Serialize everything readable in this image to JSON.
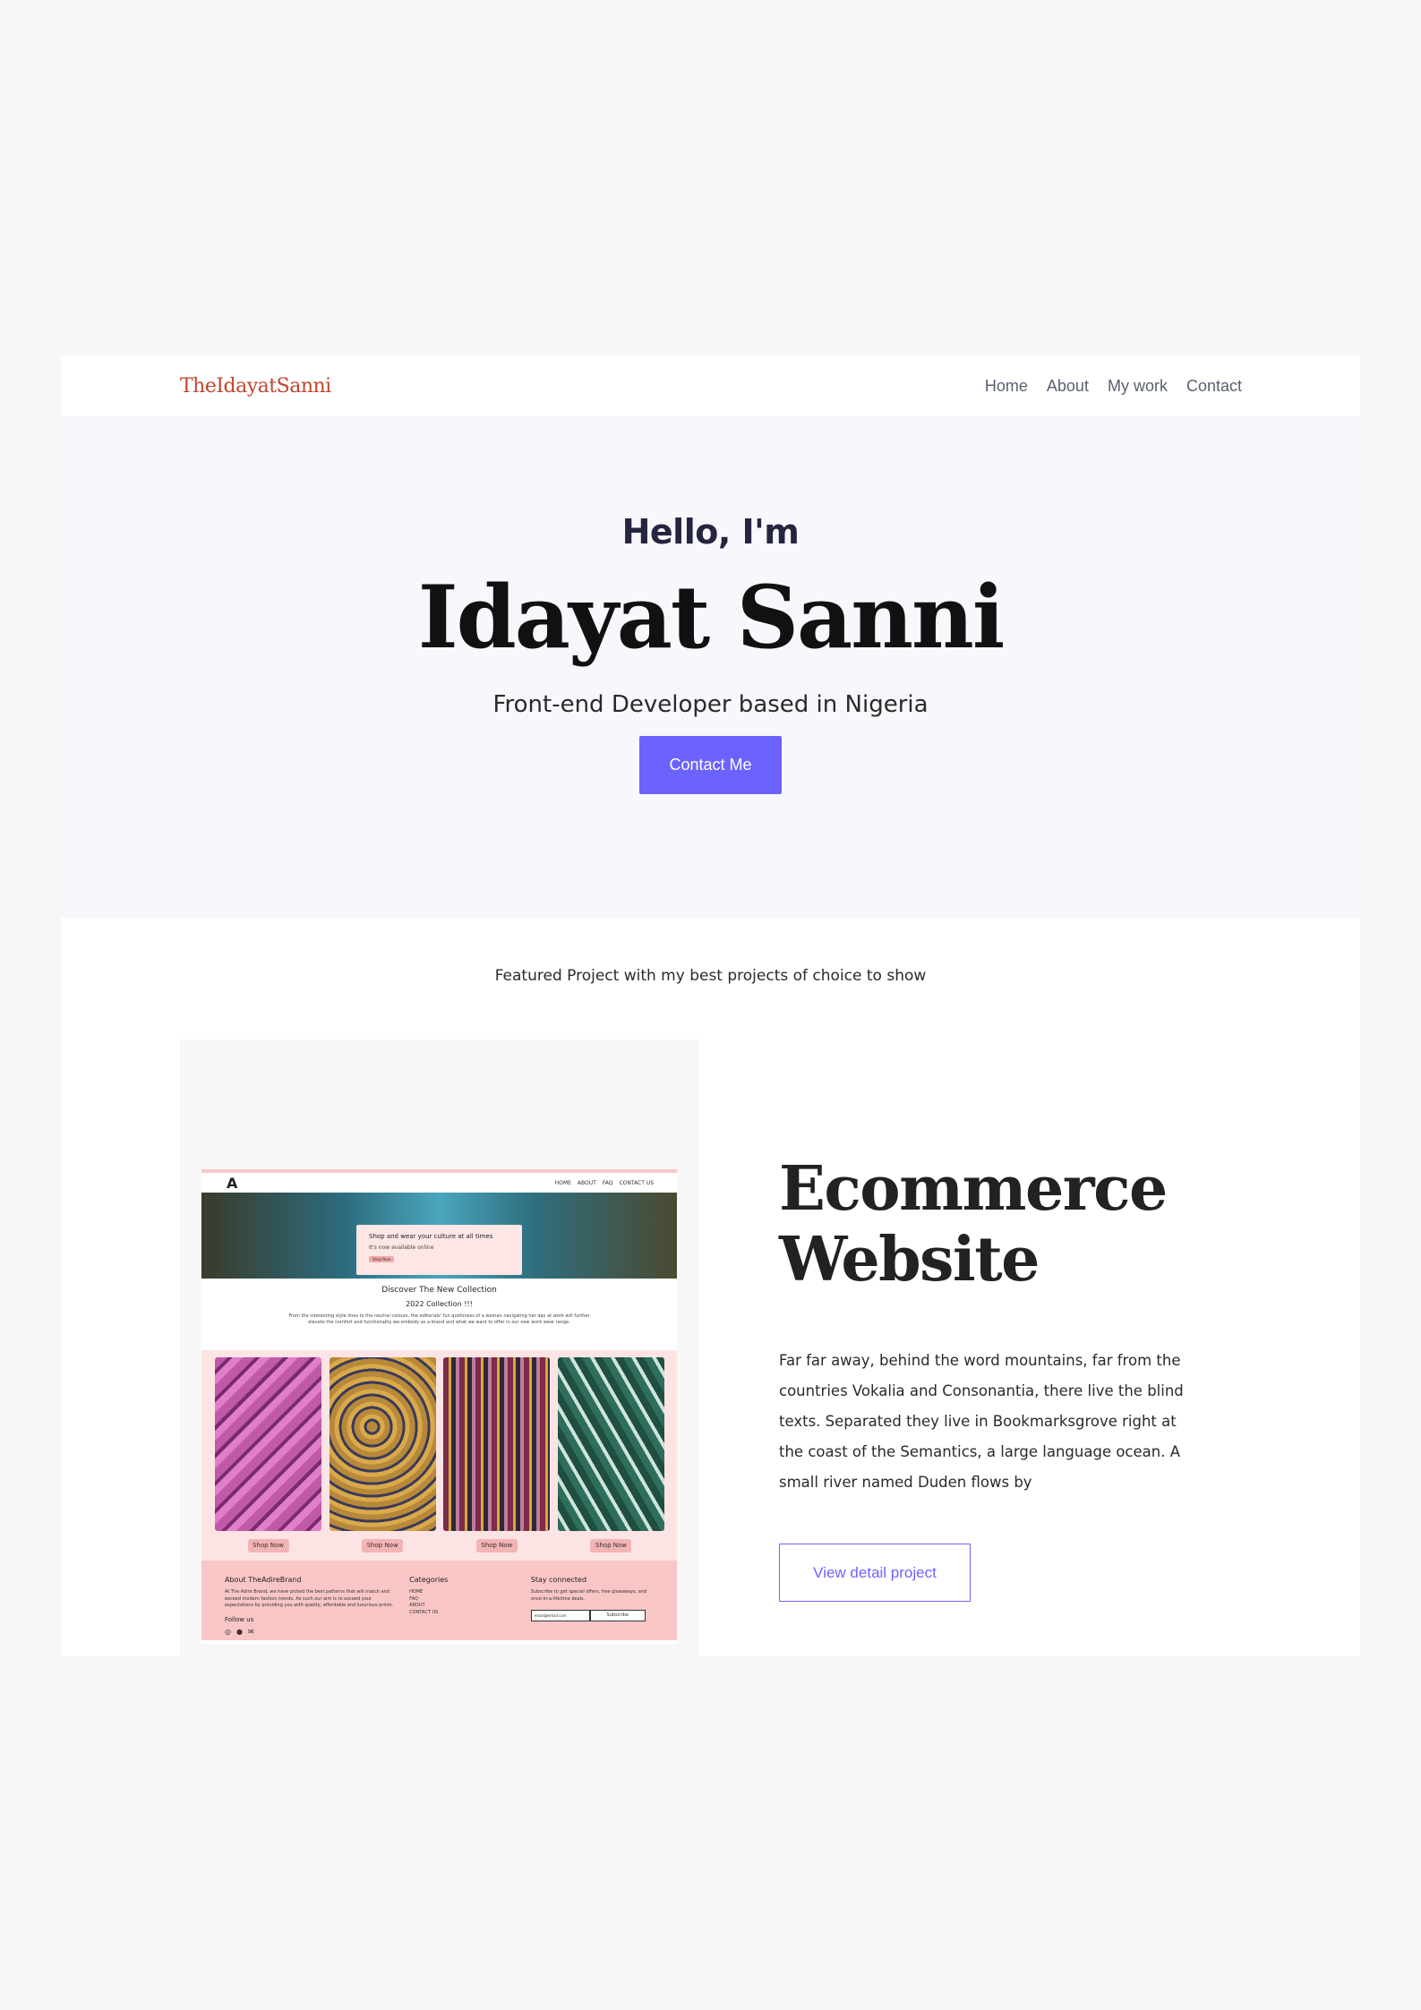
{
  "navbar": {
    "brand": "TheIdayatSanni",
    "links": [
      "Home",
      "About",
      "My work",
      "Contact"
    ]
  },
  "hero": {
    "greeting": "Hello, I'm",
    "name": "Idayat Sanni",
    "subtitle": "Front-end Developer based in Nigeria",
    "cta": "Contact Me"
  },
  "featured": {
    "heading": "Featured Project with my best projects of choice to show",
    "project": {
      "title_line1": "Ecommerce",
      "title_line2": "Website",
      "description": "Far far away, behind the word mountains, far from the countries Vokalia and Consonantia, there live the blind texts. Separated they live in Bookmarksgrove right at the coast of the Semantics, a large language ocean. A small river named Duden flows by",
      "button": "View detail project"
    },
    "mockup": {
      "logo": "A",
      "nav": [
        "HOME",
        "ABOUT",
        "FAQ",
        "CONTACT US"
      ],
      "hero_title": "Shop and wear your culture at all times",
      "hero_sub": "It's now available online",
      "hero_btn": "Shop Now",
      "collection_title": "Discover The New Collection",
      "collection_year": "2022 Collection !!!",
      "collection_text": "From the interesting style lines to the neutral colours, the editorials' fun quirkiness of a woman navigating her day at work will further elevate the comfort and functionality we embody as a brand and what we want to offer in our new work wear range.",
      "shop_btn": "Shop Now",
      "product_colors": [
        "#c05aa8",
        "#b8893a",
        "#7a2c4a",
        "#2f6e5c"
      ],
      "footer": {
        "about_title": "About TheAdireBrand",
        "about_text": "At The Adire Brand, we have picked the best patterns that will match and exceed modern fashion trends. As such our aim is to exceed your expectations by providing you with quality, affordable and luxurious prints.",
        "follow": "Follow us",
        "categories_title": "Categories",
        "categories": [
          "HOME",
          "FAQ",
          "ABOUT",
          "CONTACT US"
        ],
        "stay_title": "Stay connected",
        "stay_text": "Subscribe to get special offers, free giveaways, and once-in-a-lifetime deals.",
        "email_placeholder": "email@email.com",
        "subscribe": "Subscribe"
      }
    }
  },
  "colors": {
    "accent": "#6c63ff",
    "brand": "#c4452b"
  }
}
